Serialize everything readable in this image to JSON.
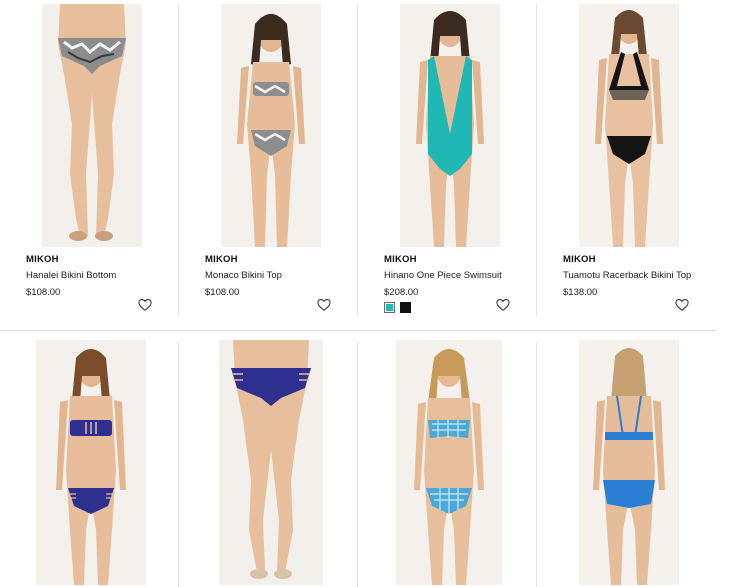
{
  "products_row_1": [
    {
      "brand": "MIKOH",
      "name": "Hanalei Bikini Bottom",
      "price": "$108.00",
      "photo": "bikini-bottom-photo",
      "colors": []
    },
    {
      "brand": "MIKOH",
      "name": "Monaco Bikini Top",
      "price": "$108.00",
      "photo": "bikini-top-photo",
      "colors": []
    },
    {
      "brand": "MIKOH",
      "name": "Hinano One Piece Swimsuit",
      "price": "$208.00",
      "photo": "one-piece-photo",
      "colors": [
        "#1fb8b5",
        "#111111"
      ],
      "selected_color": "#1fb8b5"
    },
    {
      "brand": "MIKOH",
      "name": "Tuamotu Racerback Bikini Top",
      "price": "$138.00",
      "photo": "racerback-top-photo",
      "colors": []
    }
  ],
  "products_row_2": [
    {
      "photo": "navy-bandeau-bikini-photo"
    },
    {
      "photo": "navy-bikini-bottom-photo"
    },
    {
      "photo": "gingham-bikini-photo"
    },
    {
      "photo": "blue-back-bikini-photo"
    }
  ],
  "icons": {
    "wishlist": "heart-outline-icon"
  },
  "colors": {
    "skin": "#e9c2a2",
    "print": "#8a8a8a",
    "teal": "#1fb8b5",
    "black": "#141414",
    "navy": "#2f2f8f",
    "gingham": "#4aa9d6",
    "blue": "#2a7fd4"
  }
}
